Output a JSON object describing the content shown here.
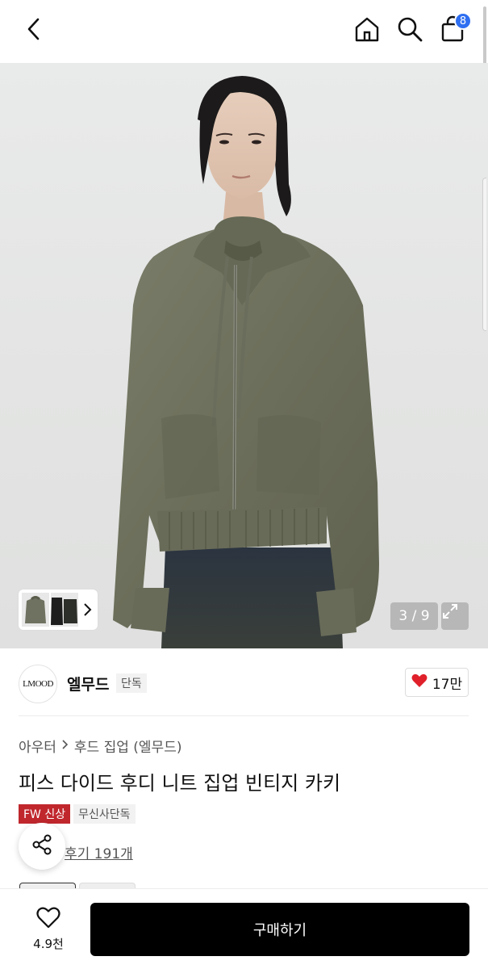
{
  "header": {
    "cart_count": "8"
  },
  "gallery": {
    "counter": "3 / 9"
  },
  "brand": {
    "logo_text": "LMOOD",
    "name": "엘무드",
    "exclusive_badge": "단독",
    "likes": "17만",
    "like_color": "#e0202b"
  },
  "product": {
    "breadcrumb": [
      "아우터",
      "후드 집업 (엘무드)"
    ],
    "title": "피스 다이드 후디 니트 집업 빈티지 카키",
    "tag_fw": "FW 신상",
    "tag_exclusive": "무신사단독",
    "review_text": "후기 191개"
  },
  "bottom": {
    "wish_count": "4.9천",
    "buy_label": "구매하기"
  },
  "colors": {
    "accent_blue": "#2f6ff1",
    "tag_red": "#c0272d",
    "buy_button": "#000000",
    "garment_khaki": "#6e725e"
  },
  "icons": [
    "back-icon",
    "home-icon",
    "search-icon",
    "cart-icon",
    "chevron-right-icon",
    "expand-icon",
    "heart-icon",
    "share-icon"
  ]
}
